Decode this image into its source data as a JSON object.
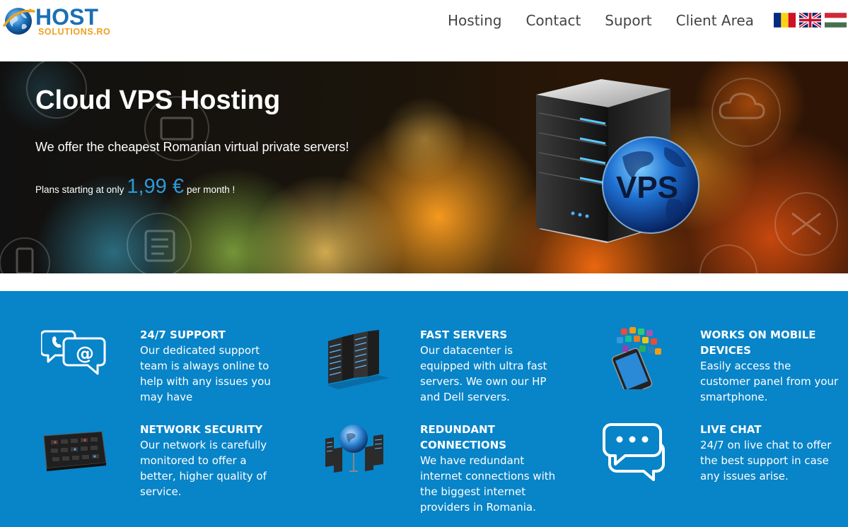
{
  "logo": {
    "host": "HOST",
    "sub": "SOLUTIONS.RO"
  },
  "nav": {
    "items": [
      {
        "label": "Hosting"
      },
      {
        "label": "Contact"
      },
      {
        "label": "Suport"
      },
      {
        "label": "Client Area"
      }
    ],
    "flags": [
      "romania-flag",
      "uk-flag",
      "hungary-flag"
    ]
  },
  "hero": {
    "title": "Cloud VPS Hosting",
    "subtitle": "We offer the cheapest Romanian virtual private servers!",
    "plans_prefix": "Plans starting at only",
    "price": "1,99 €",
    "plans_suffix": "per month !",
    "server_badge": "VPS",
    "price_color": "#2a9ad9"
  },
  "features": [
    {
      "title": "24/7 SUPPORT",
      "desc": "Our dedicated support team is always online to help with any issues you may have",
      "icon": "chat-email-icon"
    },
    {
      "title": "FAST SERVERS",
      "desc": "Our datacenter is equipped with ultra fast servers. We own our HP and Dell servers.",
      "icon": "server-rack-icon"
    },
    {
      "title": "WORKS ON MOBILE DEVICES",
      "desc": "Easily access the customer panel from your smartphone.",
      "icon": "smartphone-apps-icon"
    },
    {
      "title": "NETWORK SECURITY",
      "desc": "Our network is carefully monitored to offer a better, higher quality of service.",
      "icon": "control-panel-icon"
    },
    {
      "title": "REDUNDANT CONNECTIONS",
      "desc": "We have redundant internet connections with the biggest internet providers in Romania.",
      "icon": "network-globe-icon"
    },
    {
      "title": "LIVE CHAT",
      "desc": "24/7 on live chat to offer the best support in case any issues arise.",
      "icon": "speech-bubbles-icon"
    }
  ],
  "colors": {
    "brand_blue": "#1b6fb5",
    "brand_orange": "#f0a020",
    "feature_bg": "#0884c8"
  }
}
